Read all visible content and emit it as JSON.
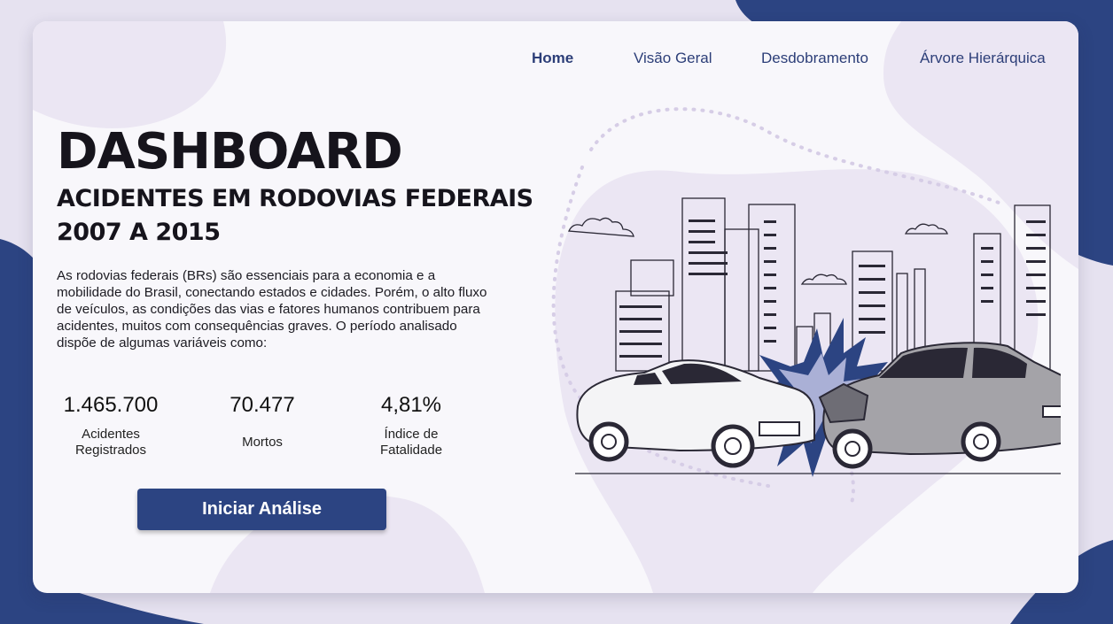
{
  "nav": {
    "items": [
      {
        "label": "Home",
        "active": true
      },
      {
        "label": "Visão Geral",
        "active": false
      },
      {
        "label": "Desdobramento",
        "active": false
      },
      {
        "label": "Árvore Hierárquica",
        "active": false
      }
    ]
  },
  "hero": {
    "title": "DASHBOARD",
    "subtitle_line1": "ACIDENTES EM RODOVIAS FEDERAIS",
    "subtitle_line2": "2007 A 2015",
    "description": "As rodovias federais (BRs) são essenciais para a economia e a mobilidade do Brasil, conectando estados e cidades. Porém, o alto fluxo de veículos, as condições das vias e fatores humanos contribuem para acidentes, muitos com consequências graves. O período analisado dispõe de algumas variáveis como:"
  },
  "stats": [
    {
      "value": "1.465.700",
      "label": "Acidentes Registrados"
    },
    {
      "value": "70.477",
      "label": "Mortos"
    },
    {
      "value": "4,81%",
      "label": "Índice de Fatalidade"
    }
  ],
  "cta": {
    "label": "Iniciar Análise"
  },
  "illustration": {
    "icon": "car-crash-city-illustration"
  },
  "colors": {
    "accent": "#2c4482",
    "background": "#e6e2f0",
    "card": "#f8f7fb",
    "blob": "#ebe6f3"
  }
}
